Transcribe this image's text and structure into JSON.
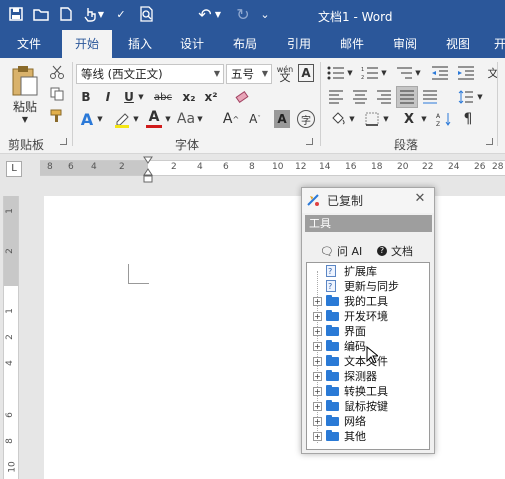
{
  "window": {
    "title": "文档1 - Word"
  },
  "quick_access": {
    "icons": [
      "save-icon",
      "open-folder-icon",
      "new-doc-icon",
      "touch-mode-icon",
      "spellcheck-icon",
      "print-preview-icon",
      "undo-icon",
      "redo-icon",
      "customize-icon"
    ]
  },
  "tabs": [
    "文件",
    "开始",
    "插入",
    "设计",
    "布局",
    "引用",
    "邮件",
    "审阅",
    "视图",
    "开"
  ],
  "active_tab": "开始",
  "ribbon": {
    "clipboard": {
      "paste_label": "粘贴",
      "group_label": "剪贴板"
    },
    "font": {
      "font_name": "等线 (西文正文)",
      "font_size": "五号",
      "phonetic_label": "wén",
      "buttons": [
        "B",
        "I",
        "U",
        "abc",
        "x₂",
        "x²"
      ],
      "group_label": "字体"
    },
    "paragraph": {
      "group_label": "段落"
    }
  },
  "ruler": {
    "horizontal": [
      "8",
      "6",
      "4",
      "2",
      "2",
      "4",
      "6",
      "8",
      "10",
      "12",
      "14",
      "16",
      "18",
      "20",
      "22",
      "24",
      "26",
      "28"
    ],
    "vertical": [
      "1",
      "2",
      "1",
      "2",
      "4",
      "6",
      "8",
      "10"
    ]
  },
  "panel": {
    "title": "已复制",
    "close": "✕",
    "toolbar_label": "工具",
    "ask_ai": "问 AI",
    "docs": "文档",
    "tree": [
      {
        "label": "扩展库",
        "type": "doc"
      },
      {
        "label": "更新与同步",
        "type": "doc"
      },
      {
        "label": "我的工具",
        "type": "folder"
      },
      {
        "label": "开发环境",
        "type": "folder"
      },
      {
        "label": "界面",
        "type": "folder"
      },
      {
        "label": "编码",
        "type": "folder"
      },
      {
        "label": "文本文件",
        "type": "folder"
      },
      {
        "label": "探测器",
        "type": "folder"
      },
      {
        "label": "转换工具",
        "type": "folder"
      },
      {
        "label": "鼠标按键",
        "type": "folder"
      },
      {
        "label": "网络",
        "type": "folder"
      },
      {
        "label": "其他",
        "type": "folder"
      }
    ]
  }
}
